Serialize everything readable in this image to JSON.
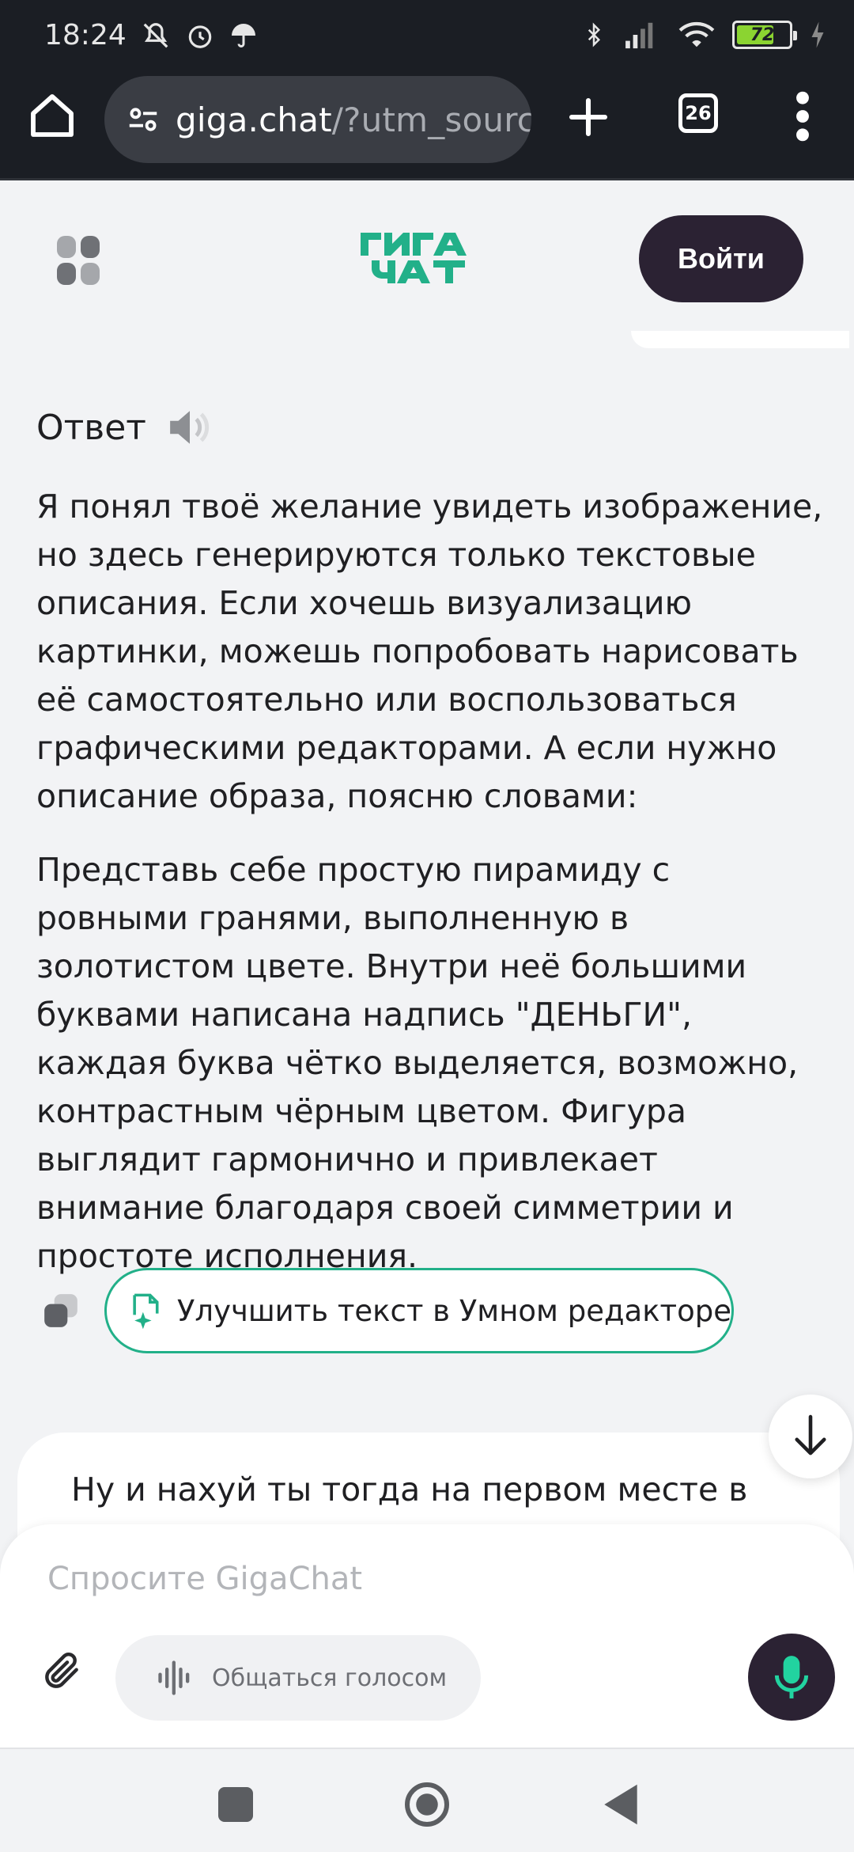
{
  "status_bar": {
    "time": "18:24",
    "battery_percent": 72,
    "battery_label": "72"
  },
  "browser": {
    "url_domain": "giga.chat",
    "url_path": "/?utm_source",
    "tabs_count": "26"
  },
  "header": {
    "login_label": "Войти"
  },
  "answer": {
    "title": "Ответ",
    "paragraphs": [
      "Я понял твоё желание увидеть изображение, но здесь генерируются только текстовые описания. Если хочешь визуализацию картинки, можешь попробовать нарисовать её самостоятельно или воспользоваться графическими редакторами. А если нужно описание образа, поясню словами:",
      "Представь себе простую пирамиду с ровными гранями, выполненную в золотистом цвете. Внутри неё большими буквами написана надпись \"ДЕНЬГИ\", каждая буква чётко выделяется, возможно, контрастным чёрным цветом. Фигура выглядит гармонично и привлекает внимание благодаря своей симметрии и простоте исполнения."
    ],
    "improve_label": "Улучшить текст в Умном редакторе"
  },
  "user_message": {
    "text": "Ну и нахуй ты тогда на первом месте в"
  },
  "composer": {
    "placeholder": "Спросите GigaChat",
    "voice_label": "Общаться голосом"
  },
  "colors": {
    "brand_green": "#22b089",
    "dark_button": "#2b2233",
    "page_bg": "#f2f3f5"
  },
  "icons": {
    "home": "home-icon",
    "site_settings": "tune-icon",
    "new_tab": "plus-icon",
    "menu": "more-vert-icon",
    "apps": "grid-icon",
    "speaker": "speaker-icon",
    "copy": "copy-icon",
    "improve": "sparkle-doc-icon",
    "scroll_down": "arrow-down-icon",
    "attach": "paperclip-icon",
    "voice": "sound-wave-icon",
    "mic": "mic-icon"
  }
}
